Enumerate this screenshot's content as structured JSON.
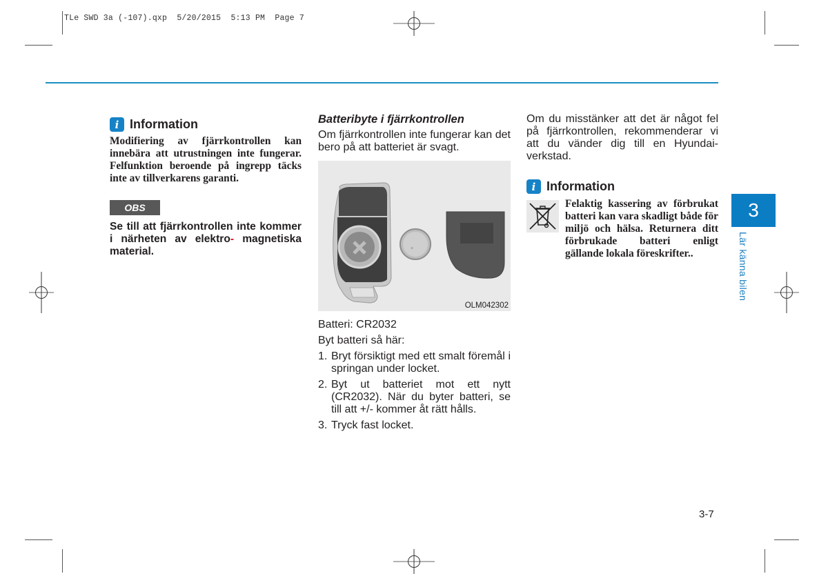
{
  "print_slug": "TLe SWD 3a (-107).qxp  5/20/2015  5:13 PM  Page 7",
  "left_column": {
    "info": {
      "icon": "info-icon",
      "icon_glyph": "i",
      "title": "Information",
      "text": "Modifiering av fjärrkontrollen kan innebära att utrustningen inte fungerar. Felfunktion beroende på ingrepp täcks inte av tillverkarens garanti."
    },
    "notice": {
      "label": "OBS",
      "text_main": "Se till att fjärrkontrollen inte kommer i närheten av elektro",
      "text_hyphen": "-",
      "text_end": "magnetiska material."
    }
  },
  "middle_column": {
    "section_title": "Batteribyte i fjärrkontrollen",
    "intro": "Om fjärrkontrollen inte fungerar kan det bero på att batteriet är svagt.",
    "figure_code": "OLM042302",
    "battery_type": "Batteri: CR2032",
    "steps_intro": "Byt batteri så här:",
    "steps": [
      {
        "num": "1.",
        "text": "Bryt försiktigt med ett smalt föremål i springan under locket."
      },
      {
        "num": "2.",
        "text": "Byt ut batteriet mot ett nytt (CR2032). När du byter batteri, se till att +/- kommer åt rätt hålls."
      },
      {
        "num": "3.",
        "text": "Tryck fast locket."
      }
    ]
  },
  "right_column": {
    "intro": "Om du misstänker att det är något fel på fjärrkontrollen, rekommenderar vi att du vänder dig till en Hyundai-verkstad.",
    "info": {
      "icon": "info-icon",
      "icon_glyph": "i",
      "title": "Information",
      "symbol": "crossed-out-wheelie-bin-icon",
      "text": "Felaktig kassering av förbrukat batteri kan vara skadligt både för miljö och hälsa. Returnera ditt förbrukade batteri enligt gällande lokala föreskrifter.."
    }
  },
  "chapter_tab": {
    "number": "3",
    "title": "Lär känna bilen"
  },
  "page_number": "3-7",
  "colors": {
    "accent_blue": "#0b7dc3",
    "rule_blue": "#1a8ec2",
    "obs_gray": "#585858",
    "hyphen_red": "#d71920"
  }
}
